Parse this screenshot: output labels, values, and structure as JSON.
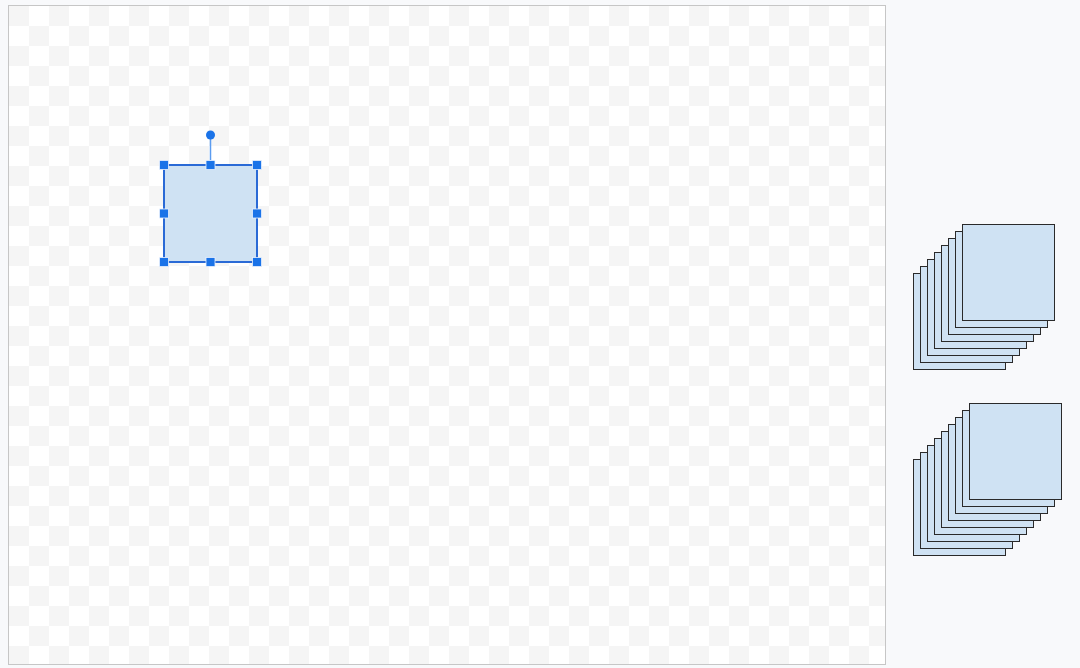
{
  "canvas": {
    "shapes": [
      {
        "kind": "square",
        "selected": true
      }
    ]
  },
  "side_panel": {
    "stacks": [
      {
        "layers": [
          {
            "kind": "square"
          },
          {
            "kind": "square"
          },
          {
            "kind": "square"
          },
          {
            "kind": "square"
          },
          {
            "kind": "square"
          },
          {
            "kind": "square"
          },
          {
            "kind": "square"
          },
          {
            "kind": "square"
          }
        ]
      },
      {
        "layers": [
          {
            "kind": "square"
          },
          {
            "kind": "square"
          },
          {
            "kind": "square"
          },
          {
            "kind": "square"
          },
          {
            "kind": "square"
          },
          {
            "kind": "square"
          },
          {
            "kind": "square"
          },
          {
            "kind": "square"
          },
          {
            "kind": "square"
          }
        ]
      }
    ]
  }
}
